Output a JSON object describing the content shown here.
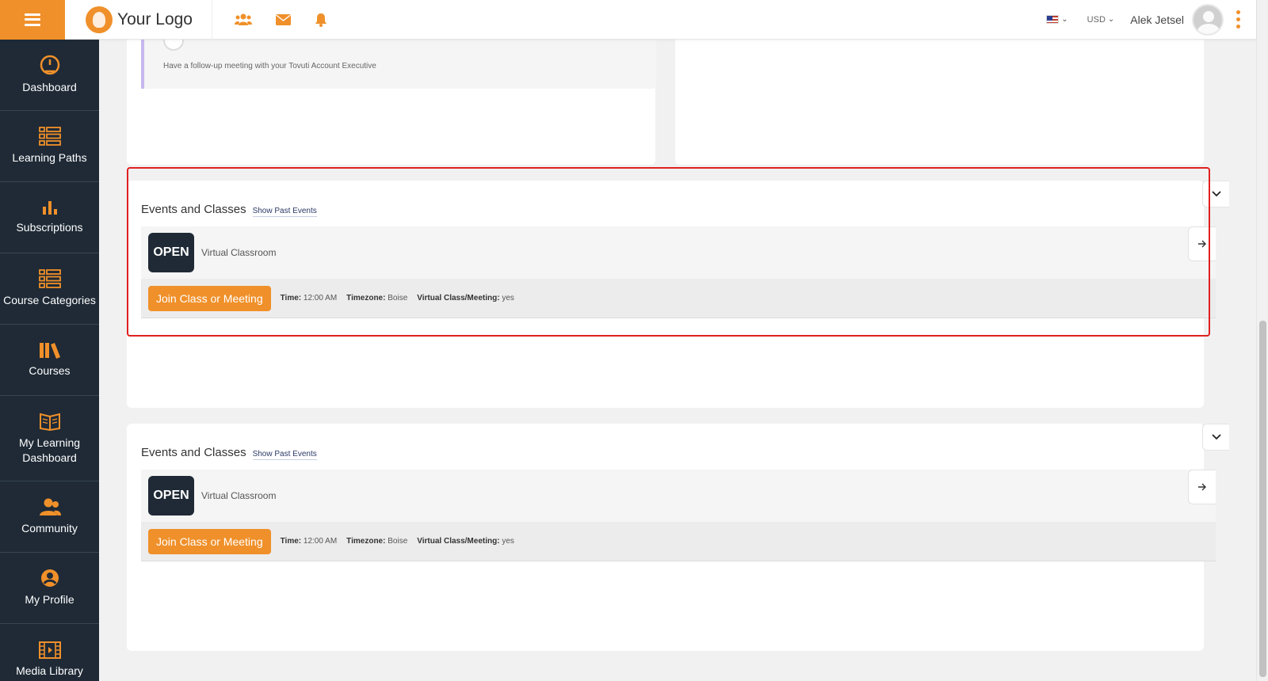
{
  "topbar": {
    "logo_text": "Your Logo",
    "currency": "USD",
    "user_name": "Alek Jetsel"
  },
  "sidebar": {
    "items": [
      {
        "label": "Dashboard",
        "icon": "gauge-icon"
      },
      {
        "label": "Learning Paths",
        "icon": "list-icon"
      },
      {
        "label": "Subscriptions",
        "icon": "bar-chart-icon"
      },
      {
        "label": "Course Categories",
        "icon": "list-icon"
      },
      {
        "label": "Courses",
        "icon": "books-icon"
      },
      {
        "label": "My Learning Dashboard",
        "icon": "open-book-icon"
      },
      {
        "label": "Community",
        "icon": "people-icon"
      },
      {
        "label": "My Profile",
        "icon": "user-circle-icon"
      },
      {
        "label": "Media Library",
        "icon": "film-icon"
      }
    ]
  },
  "todo": {
    "description": "Have a follow-up meeting with your Tovuti Account Executive"
  },
  "events_blocks": [
    {
      "title": "Events and Classes",
      "past_link": "Show Past Events",
      "badge": "OPEN",
      "event_name": "Virtual Classroom",
      "join_label": "Join Class or Meeting",
      "time_label": "Time:",
      "time_value": "12:00 AM",
      "timezone_label": "Timezone:",
      "timezone_value": "Boise",
      "virtual_label": "Virtual Class/Meeting:",
      "virtual_value": "yes"
    },
    {
      "title": "Events and Classes",
      "past_link": "Show Past Events",
      "badge": "OPEN",
      "event_name": "Virtual Classroom",
      "join_label": "Join Class or Meeting",
      "time_label": "Time:",
      "time_value": "12:00 AM",
      "timezone_label": "Timezone:",
      "timezone_value": "Boise",
      "virtual_label": "Virtual Class/Meeting:",
      "virtual_value": "yes"
    }
  ],
  "colors": {
    "accent": "#f0902a",
    "sidebar_bg": "#1f2a36",
    "highlight": "#e02020"
  }
}
